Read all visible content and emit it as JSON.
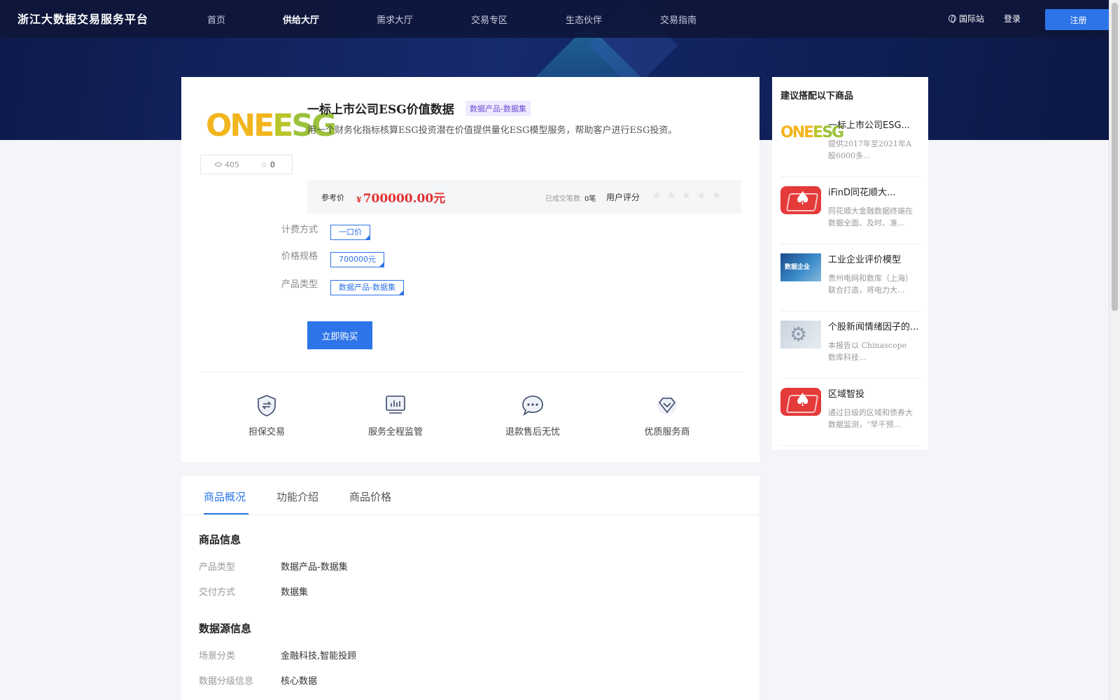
{
  "nav": {
    "brand": "浙江大数据交易服务平台",
    "items": [
      "首页",
      "供给大厅",
      "需求大厅",
      "交易专区",
      "生态伙伴",
      "交易指南"
    ],
    "active_index": 1,
    "intl": "国际站",
    "login": "登录",
    "register": "注册"
  },
  "product": {
    "logo_one": "ONE",
    "logo_esg": "SG",
    "logo_e": "E",
    "views": "405",
    "favorites": "0",
    "title": "一标上市公司ESG价值数据",
    "tag": "数据产品-数据集",
    "description": "用一个财务化指标核算ESG投资潜在价值提供量化ESG模型服务，帮助客户进行ESG投资。",
    "price_label": "参考价",
    "price_symbol": "¥",
    "price": "700000.00元",
    "deals_label": "已成交笔数",
    "deals_value": "0笔",
    "rating_label": "用户评分",
    "rating_stars": 0,
    "rating_max": 5,
    "specs": [
      {
        "label": "计费方式",
        "option": "一口价"
      },
      {
        "label": "价格规格",
        "option": "700000元"
      },
      {
        "label": "产品类型",
        "option": "数据产品-数据集"
      }
    ],
    "buy_label": "立即购买",
    "guarantees": [
      "担保交易",
      "服务全程监管",
      "退款售后无忧",
      "优质服务商"
    ]
  },
  "sidebar": {
    "title": "建议搭配以下商品",
    "items": [
      {
        "name": "一标上市公司ESG...",
        "desc": "提供2017年至2021年A股6000多...",
        "thumb": "onesg-logo"
      },
      {
        "name": "iFinD同花顺大...",
        "desc": "同花顺大金融数据终端在数据全面、及时、准...",
        "thumb": "ifind-logo"
      },
      {
        "name": "工业企业评价模型",
        "desc": "贵州电网和数库（上海）联合打造，将电力大...",
        "thumb": "industry-image",
        "thumb_text": "数据企业"
      },
      {
        "name": "个股新闻情绪因子的...",
        "desc": "本报告以 Chinascope 数库科技...",
        "thumb": "gear-image"
      },
      {
        "name": "区域智投",
        "desc": "通过日级的区域和债券大数据监测，“早干预...",
        "thumb": "ifind-logo"
      }
    ]
  },
  "details": {
    "tabs": [
      "商品概况",
      "功能介绍",
      "商品价格"
    ],
    "active_tab": 0,
    "sections": [
      {
        "heading": "商品信息",
        "rows": [
          {
            "k": "产品类型",
            "v": "数据产品-数据集"
          },
          {
            "k": "交付方式",
            "v": "数据集"
          }
        ]
      },
      {
        "heading": "数据源信息",
        "rows": [
          {
            "k": "场景分类",
            "v": "金融科技,智能投顾"
          },
          {
            "k": "数据分级信息",
            "v": "核心数据"
          }
        ]
      }
    ]
  },
  "colors": {
    "accent": "#2d74e8",
    "price": "#e23030",
    "nav_bg": "#0e163a"
  }
}
